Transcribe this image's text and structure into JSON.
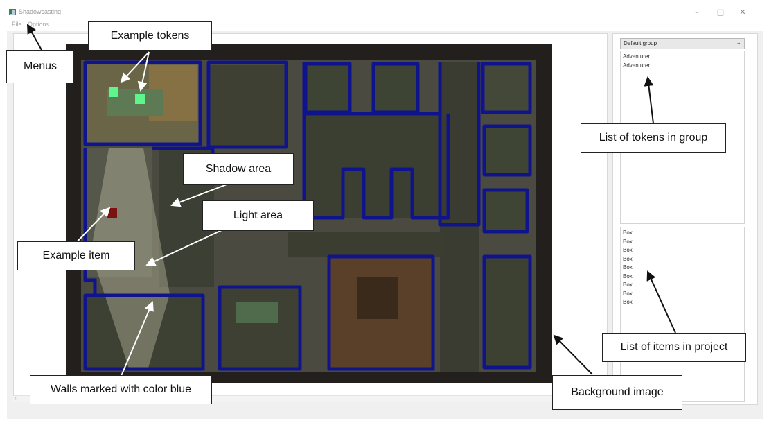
{
  "window": {
    "title": "Shadowcasting",
    "minimize_icon": "–",
    "maximize_icon": "□",
    "close_icon": "✕"
  },
  "menubar": {
    "file": "File",
    "options": "Options"
  },
  "side_panel": {
    "group_select": {
      "value": "Default group"
    },
    "tokens": [
      "Adventurer",
      "Adventurer"
    ],
    "items": [
      "Box",
      "Box",
      "Box",
      "Box",
      "Box",
      "Box",
      "Box",
      "Box",
      "Box"
    ]
  },
  "annotations": {
    "menus": "Menus",
    "example_tokens": "Example tokens",
    "shadow_area": "Shadow area",
    "light_area": "Light area",
    "example_item": "Example item",
    "walls": "Walls marked with color blue",
    "token_list": "List of tokens in group",
    "item_list": "List of items in project",
    "background_image": "Background image"
  },
  "colors": {
    "wall": "#10148c",
    "token": "#5ff58a",
    "item": "#7a1212",
    "floor": "#3e4133",
    "backdrop": "#221f1c"
  }
}
